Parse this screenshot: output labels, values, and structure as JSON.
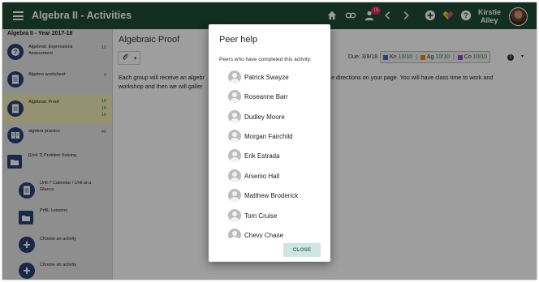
{
  "header": {
    "title": "Algebra II - Activities",
    "notification_count": "19",
    "user_first": "Kirstie",
    "user_last": "Alley",
    "icons": [
      "home-icon",
      "link-icon",
      "person-icon",
      "chevron-left-icon",
      "chevron-right-icon",
      "add-circle-icon",
      "heart-icon",
      "help-icon"
    ]
  },
  "sidebar": {
    "course_title": "Algebra II - Year 2017-18",
    "items": [
      {
        "label": "Algebraic Expressions Assessment",
        "scores": [
          "10"
        ],
        "icon": "question-icon"
      },
      {
        "label": "Algebra worksheet",
        "scores": [
          "9"
        ],
        "icon": "document-icon"
      },
      {
        "label": "Algebraic Proof",
        "scores": [
          "10",
          "10",
          "10"
        ],
        "icon": "document-icon"
      },
      {
        "label": "algebra practice",
        "scores": [
          "40"
        ],
        "icon": "book-icon"
      },
      {
        "label": "[Unit 7] Problem Solving",
        "scores": [],
        "icon": "folder-icon"
      },
      {
        "label": "Unit 7 Calendar / Unit at a Glance",
        "scores": [],
        "icon": "document-icon"
      },
      {
        "label": "PrBL Lessons",
        "scores": [],
        "icon": "folder-icon"
      },
      {
        "label": "Choose an activity",
        "scores": [],
        "icon": "plus-icon"
      },
      {
        "label": "Choose an activity",
        "scores": [],
        "icon": "plus-icon"
      }
    ]
  },
  "main": {
    "title": "Algebraic Proof",
    "due": "Due: 3/8/18",
    "standards": [
      {
        "code": "Kn",
        "value": "10/10",
        "color": "#3a6fc4"
      },
      {
        "code": "Ag",
        "value": "10/10",
        "color": "#e08a1e"
      },
      {
        "code": "Co",
        "value": "10/10",
        "color": "#8a4fc4"
      }
    ],
    "desc_left": "Each group will receive an algebr",
    "desc_right": "e directions on your page.  You will have class time to work and",
    "desc_line2": "workshop and then we will galler"
  },
  "dialog": {
    "title": "Peer help",
    "subtitle": "Peers who have completed this activity:",
    "peers": [
      "Patrick Swayze",
      "Roseanne Barr",
      "Dudley Moore",
      "Morgan Fairchild",
      "Erik Estrada",
      "Arsenio Hall",
      "Matthew Broderick",
      "Tom Cruise",
      "Chevy Chase"
    ],
    "close_label": "CLOSE"
  }
}
